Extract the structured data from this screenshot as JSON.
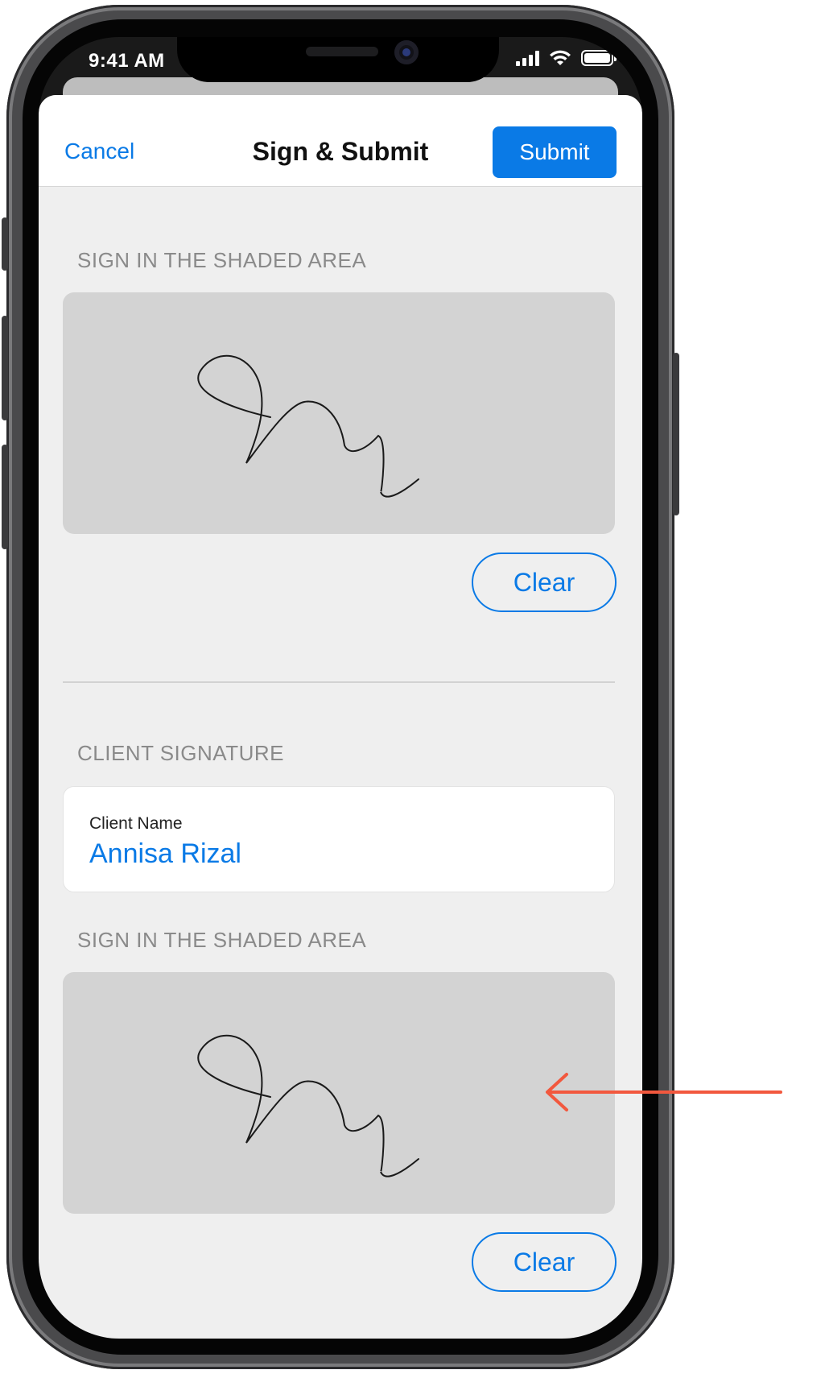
{
  "status_bar": {
    "time": "9:41 AM",
    "icons": [
      "cellular-signal-icon",
      "wifi-icon",
      "battery-icon"
    ]
  },
  "nav": {
    "cancel_label": "Cancel",
    "title": "Sign & Submit",
    "submit_label": "Submit"
  },
  "sections": {
    "first_sign_label": "SIGN IN THE SHADED AREA",
    "first_clear_label": "Clear",
    "client_section_label": "CLIENT SIGNATURE",
    "client_name_label": "Client Name",
    "client_name_value": "Annisa Rizal",
    "second_sign_label": "SIGN IN THE SHADED AREA",
    "second_clear_label": "Clear"
  },
  "colors": {
    "accent": "#0a7ae6",
    "sheet_background": "#efefef",
    "signature_pad": "#d3d3d3",
    "annotation_arrow": "#f2583e"
  }
}
